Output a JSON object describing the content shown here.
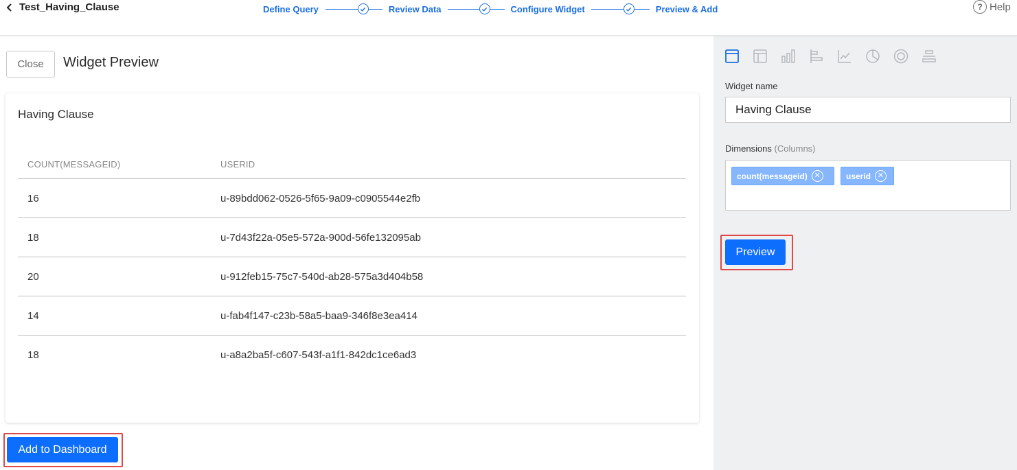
{
  "header": {
    "back_title": "Test_Having_Clause",
    "steps": [
      {
        "label": "Define Query"
      },
      {
        "label": "Review Data"
      },
      {
        "label": "Configure Widget"
      },
      {
        "label": "Preview & Add"
      }
    ],
    "help_label": "Help"
  },
  "left": {
    "close_label": "Close",
    "page_title": "Widget Preview",
    "card_title": "Having Clause",
    "table": {
      "columns": [
        "COUNT(MESSAGEID)",
        "USERID"
      ],
      "rows": [
        [
          "16",
          "u-89bdd062-0526-5f65-9a09-c0905544e2fb"
        ],
        [
          "18",
          "u-7d43f22a-05e5-572a-900d-56fe132095ab"
        ],
        [
          "20",
          "u-912feb15-75c7-540d-ab28-575a3d404b58"
        ],
        [
          "14",
          "u-fab4f147-c23b-58a5-baa9-346f8e3ea414"
        ],
        [
          "18",
          "u-a8a2ba5f-c607-543f-a1f1-842dc1ce6ad3"
        ]
      ]
    },
    "add_label": "Add to Dashboard"
  },
  "right": {
    "widget_types": [
      "table-widget-icon",
      "pivot-table-icon",
      "bar-chart-icon",
      "horizontal-bar-icon",
      "line-chart-icon",
      "pie-chart-icon",
      "donut-chart-icon",
      "stacked-bar-icon"
    ],
    "widget_name_label": "Widget name",
    "widget_name_value": "Having Clause",
    "dimensions_label": "Dimensions",
    "dimensions_sub": "(Columns)",
    "dimension_chips": [
      "count(messageid)",
      "userid"
    ],
    "preview_label": "Preview"
  },
  "colors": {
    "accent": "#0d6efd",
    "step_blue": "#1a6fdf",
    "chip": "#86b7fe",
    "highlight": "#e04848",
    "panel_bg": "#eef0f2"
  }
}
